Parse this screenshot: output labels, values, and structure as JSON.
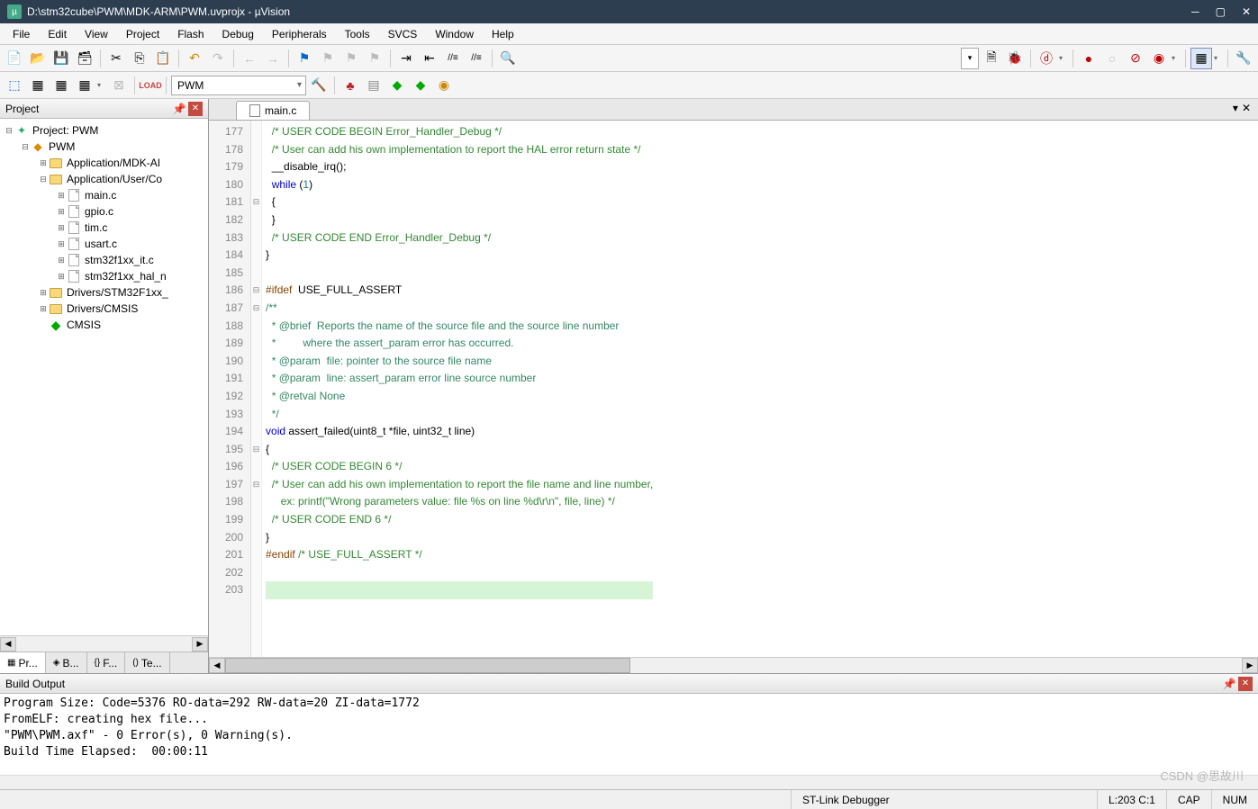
{
  "window": {
    "title": "D:\\stm32cube\\PWM\\MDK-ARM\\PWM.uvprojx - µVision"
  },
  "menu": [
    "File",
    "Edit",
    "View",
    "Project",
    "Flash",
    "Debug",
    "Peripherals",
    "Tools",
    "SVCS",
    "Window",
    "Help"
  ],
  "toolbar2": {
    "target_combo": "PWM"
  },
  "project_panel": {
    "title": "Project",
    "tree": {
      "root": "Project: PWM",
      "target": "PWM",
      "groups": [
        {
          "name": "Application/MDK-AI",
          "expanded": false
        },
        {
          "name": "Application/User/Co",
          "expanded": true,
          "files": [
            "main.c",
            "gpio.c",
            "tim.c",
            "usart.c",
            "stm32f1xx_it.c",
            "stm32f1xx_hal_n"
          ]
        },
        {
          "name": "Drivers/STM32F1xx_",
          "expanded": false
        },
        {
          "name": "Drivers/CMSIS",
          "expanded": false
        }
      ],
      "cmsis": "CMSIS"
    },
    "tabs": [
      "Pr...",
      "B...",
      "F...",
      "Te..."
    ]
  },
  "editor": {
    "tab": "main.c",
    "first_line": 177,
    "lines": [
      {
        "t": "  /* USER CODE BEGIN Error_Handler_Debug */",
        "cls": "c-comment"
      },
      {
        "t": "  /* User can add his own implementation to report the HAL error return state */",
        "cls": "c-comment"
      },
      {
        "raw": "  __disable_irq();"
      },
      {
        "raw": "  <span class='c-keyword'>while</span> (<span class='c-num'>1</span>)"
      },
      {
        "raw": "  {",
        "fold": "⊟"
      },
      {
        "raw": "  }"
      },
      {
        "t": "  /* USER CODE END Error_Handler_Debug */",
        "cls": "c-comment"
      },
      {
        "raw": "}"
      },
      {
        "raw": ""
      },
      {
        "raw": "<span class='c-pre'>#ifdef</span>  USE_FULL_ASSERT",
        "fold": "⊟"
      },
      {
        "t": "/**",
        "cls": "c-doc",
        "fold": "⊟"
      },
      {
        "t": "  * @brief  Reports the name of the source file and the source line number",
        "cls": "c-doc"
      },
      {
        "t": "  *         where the assert_param error has occurred.",
        "cls": "c-doc"
      },
      {
        "t": "  * @param  file: pointer to the source file name",
        "cls": "c-doc"
      },
      {
        "t": "  * @param  line: assert_param error line source number",
        "cls": "c-doc"
      },
      {
        "t": "  * @retval None",
        "cls": "c-doc"
      },
      {
        "t": "  */",
        "cls": "c-doc"
      },
      {
        "raw": "<span class='c-keyword'>void</span> assert_failed(uint8_t *file, uint32_t line)"
      },
      {
        "raw": "{",
        "fold": "⊟"
      },
      {
        "t": "  /* USER CODE BEGIN 6 */",
        "cls": "c-comment"
      },
      {
        "t": "  /* User can add his own implementation to report the file name and line number,",
        "cls": "c-comment",
        "fold": "⊟"
      },
      {
        "t": "     ex: printf(\"Wrong parameters value: file %s on line %d\\r\\n\", file, line) */",
        "cls": "c-comment"
      },
      {
        "t": "  /* USER CODE END 6 */",
        "cls": "c-comment"
      },
      {
        "raw": "}"
      },
      {
        "raw": "<span class='c-pre'>#endif</span> <span class='c-comment'>/* USE_FULL_ASSERT */</span>"
      },
      {
        "raw": ""
      },
      {
        "raw": "",
        "hl": true
      }
    ]
  },
  "build_output": {
    "title": "Build Output",
    "lines": [
      "Program Size: Code=5376 RO-data=292 RW-data=20 ZI-data=1772",
      "FromELF: creating hex file...",
      "\"PWM\\PWM.axf\" - 0 Error(s), 0 Warning(s).",
      "Build Time Elapsed:  00:00:11"
    ]
  },
  "statusbar": {
    "debugger": "ST-Link Debugger",
    "cursor": "L:203 C:1",
    "caps": "CAP",
    "num": "NUM"
  },
  "watermark": "CSDN @思故川"
}
